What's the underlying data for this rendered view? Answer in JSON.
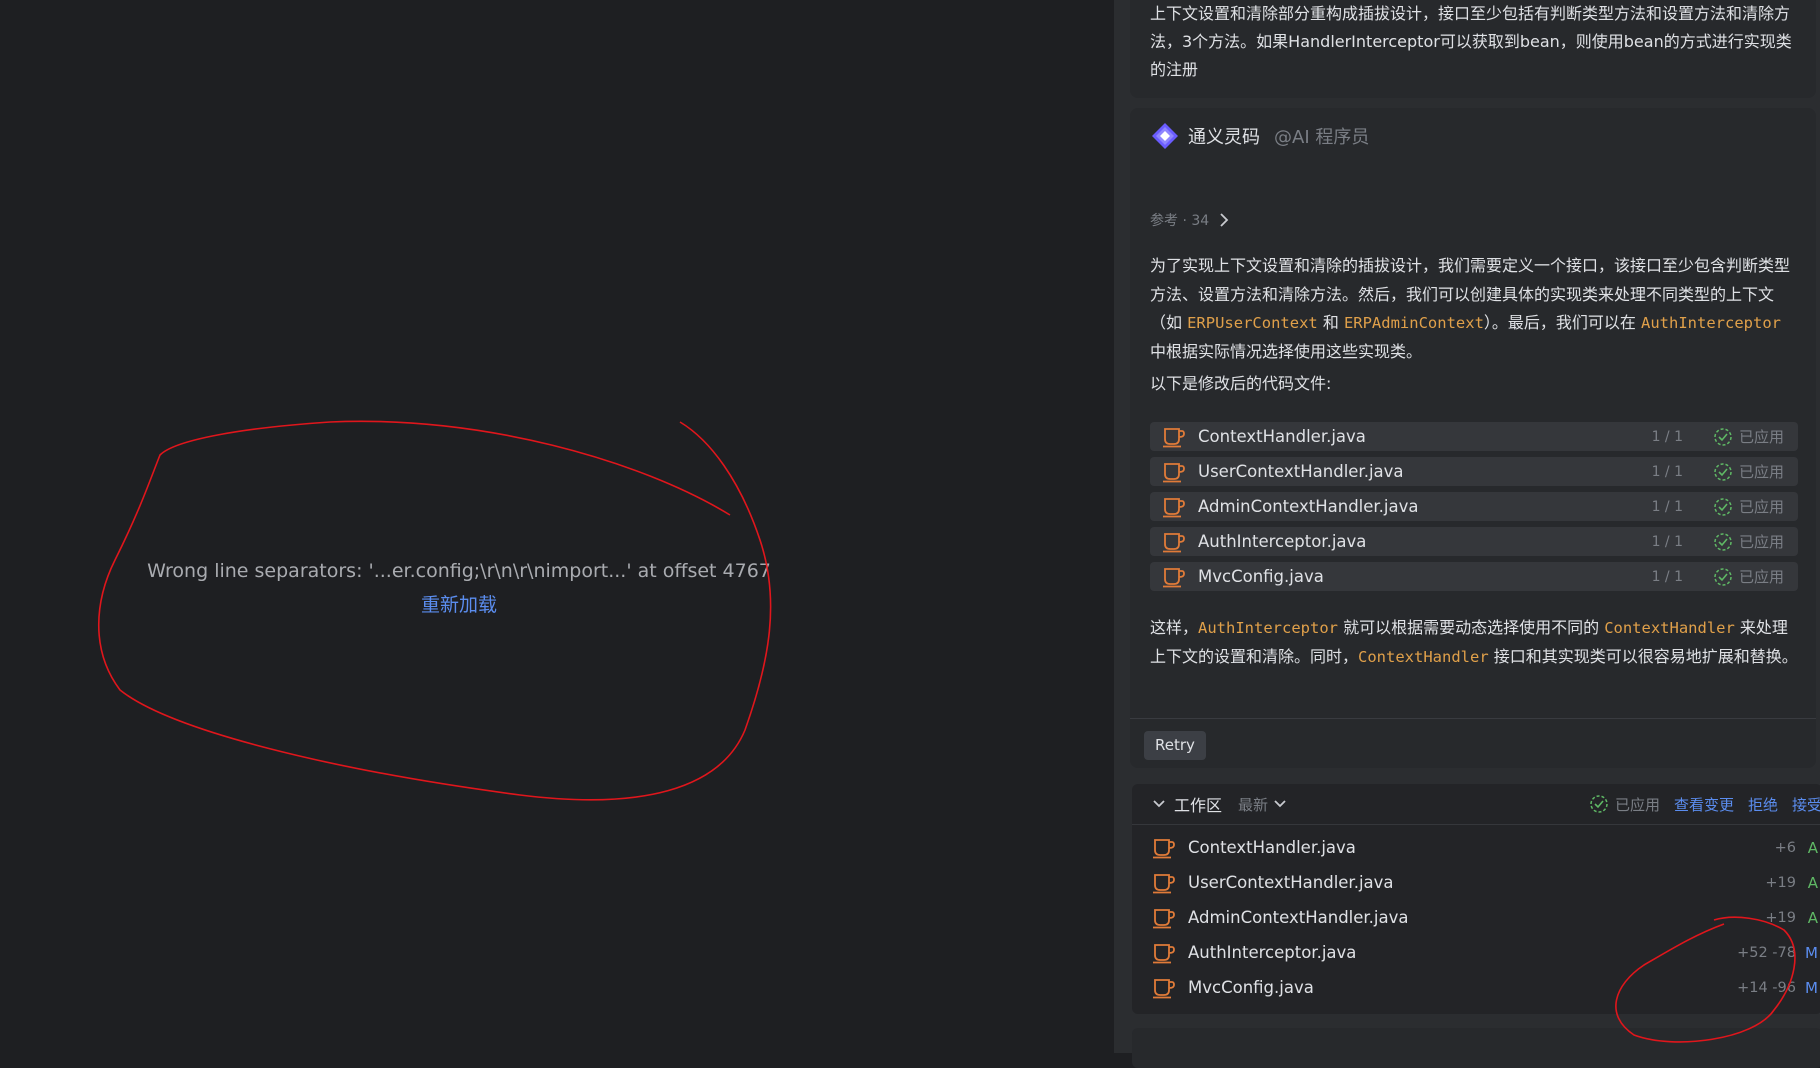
{
  "editor": {
    "error_message": "Wrong line separators: '...er.config;\\r\\n\\r\\nimport...' at offset 4767",
    "reload_label": "重新加载"
  },
  "chat": {
    "previous_message": "上下文设置和清除部分重构成插拔设计，接口至少包括有判断类型方法和设置方法和清除方法，3个方法。如果HandlerInterceptor可以获取到bean，则使用bean的方式进行实现类的注册",
    "assistant": {
      "name": "通义灵码",
      "handle": "@AI 程序员",
      "references": "参考 · 34",
      "intro": {
        "p1": "为了实现上下文设置和清除的插拔设计，我们需要定义一个接口，该接口至少包含判断类型方法、设置方法和清除方法。然后，我们可以创建具体的实现类来处理不同类型的上下文（如 ",
        "c1": "ERPUserContext",
        "p2": " 和 ",
        "c2": "ERPAdminContext",
        "p3": "）。最后，我们可以在 ",
        "c3": "AuthInterceptor",
        "p4": " 中根据实际情况选择使用这些实现类。"
      },
      "modified_heading": "以下是修改后的代码文件:",
      "files": [
        {
          "name": "ContextHandler.java",
          "count": "1 / 1",
          "status": "已应用"
        },
        {
          "name": "UserContextHandler.java",
          "count": "1 / 1",
          "status": "已应用"
        },
        {
          "name": "AdminContextHandler.java",
          "count": "1 / 1",
          "status": "已应用"
        },
        {
          "name": "AuthInterceptor.java",
          "count": "1 / 1",
          "status": "已应用"
        },
        {
          "name": "MvcConfig.java",
          "count": "1 / 1",
          "status": "已应用"
        }
      ],
      "outro": {
        "p1": "这样，",
        "c1": "AuthInterceptor",
        "p2": " 就可以根据需要动态选择使用不同的 ",
        "c2": "ContextHandler",
        "p3": " 来处理上下文的设置和清除。同时，",
        "c3": "ContextHandler",
        "p4": " 接口和其实现类可以很容易地扩展和替换。"
      },
      "retry_label": "Retry"
    },
    "workspace": {
      "title": "工作区",
      "filter": "最新",
      "applied_label": "已应用",
      "view_changes": "查看变更",
      "reject": "拒绝",
      "accept": "接受",
      "files": [
        {
          "name": "ContextHandler.java",
          "diff": "+6",
          "status": "A"
        },
        {
          "name": "UserContextHandler.java",
          "diff": "+19",
          "status": "A"
        },
        {
          "name": "AdminContextHandler.java",
          "diff": "+19",
          "status": "A"
        },
        {
          "name": "AuthInterceptor.java",
          "diff": "+52 -78",
          "status": "M"
        },
        {
          "name": "MvcConfig.java",
          "diff": "+14 -96",
          "status": "M"
        }
      ]
    }
  },
  "colors": {
    "accent_link": "#5b8def",
    "code": "#e0a04a",
    "added": "#5fb865",
    "modified": "#5b8def",
    "annotation": "#e0161c",
    "java_icon": "#e07b39"
  }
}
